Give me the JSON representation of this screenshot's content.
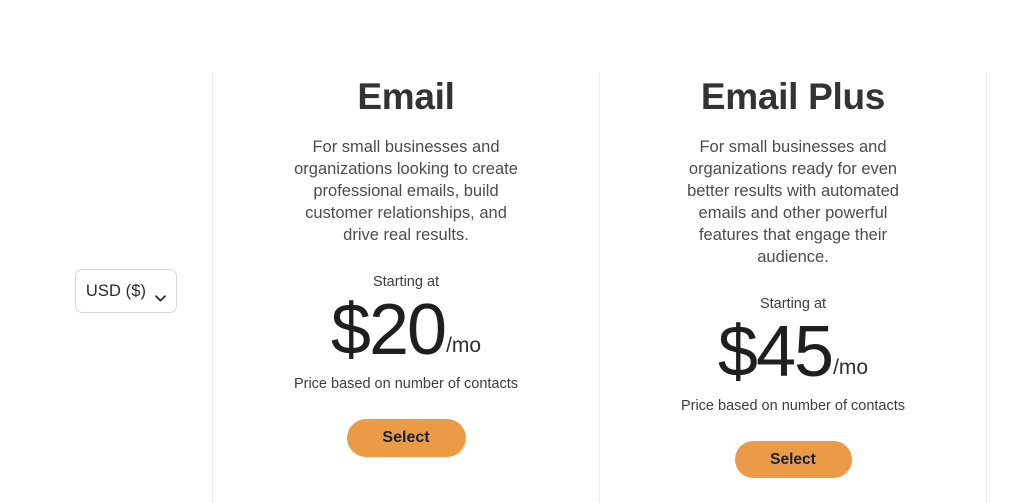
{
  "currency_selector": {
    "name": "currency-selector",
    "selected": "USD ($)",
    "icon": "chevron-down-icon",
    "options": [
      "USD ($)"
    ]
  },
  "plans": [
    {
      "id": "email",
      "title": "Email",
      "description": "For small businesses and organizations looking to create professional emails, build customer relationships, and drive real results.",
      "starting_at_label": "Starting at",
      "price": "$20",
      "period": "/mo",
      "price_note": "Price based on number of contacts",
      "cta_label": "Select"
    },
    {
      "id": "email-plus",
      "title": "Email Plus",
      "description": "For small businesses and organizations ready for even better results with automated emails and other powerful features that engage their audience.",
      "starting_at_label": "Starting at",
      "price": "$45",
      "period": "/mo",
      "price_note": "Price based on number of contacts",
      "cta_label": "Select"
    }
  ],
  "colors": {
    "cta_background": "#eb9b45",
    "cta_text": "#16213f",
    "title_text": "#333333",
    "body_text": "#4c4c4c",
    "divider": "#eaeaea",
    "page_background": "#ffffff"
  }
}
